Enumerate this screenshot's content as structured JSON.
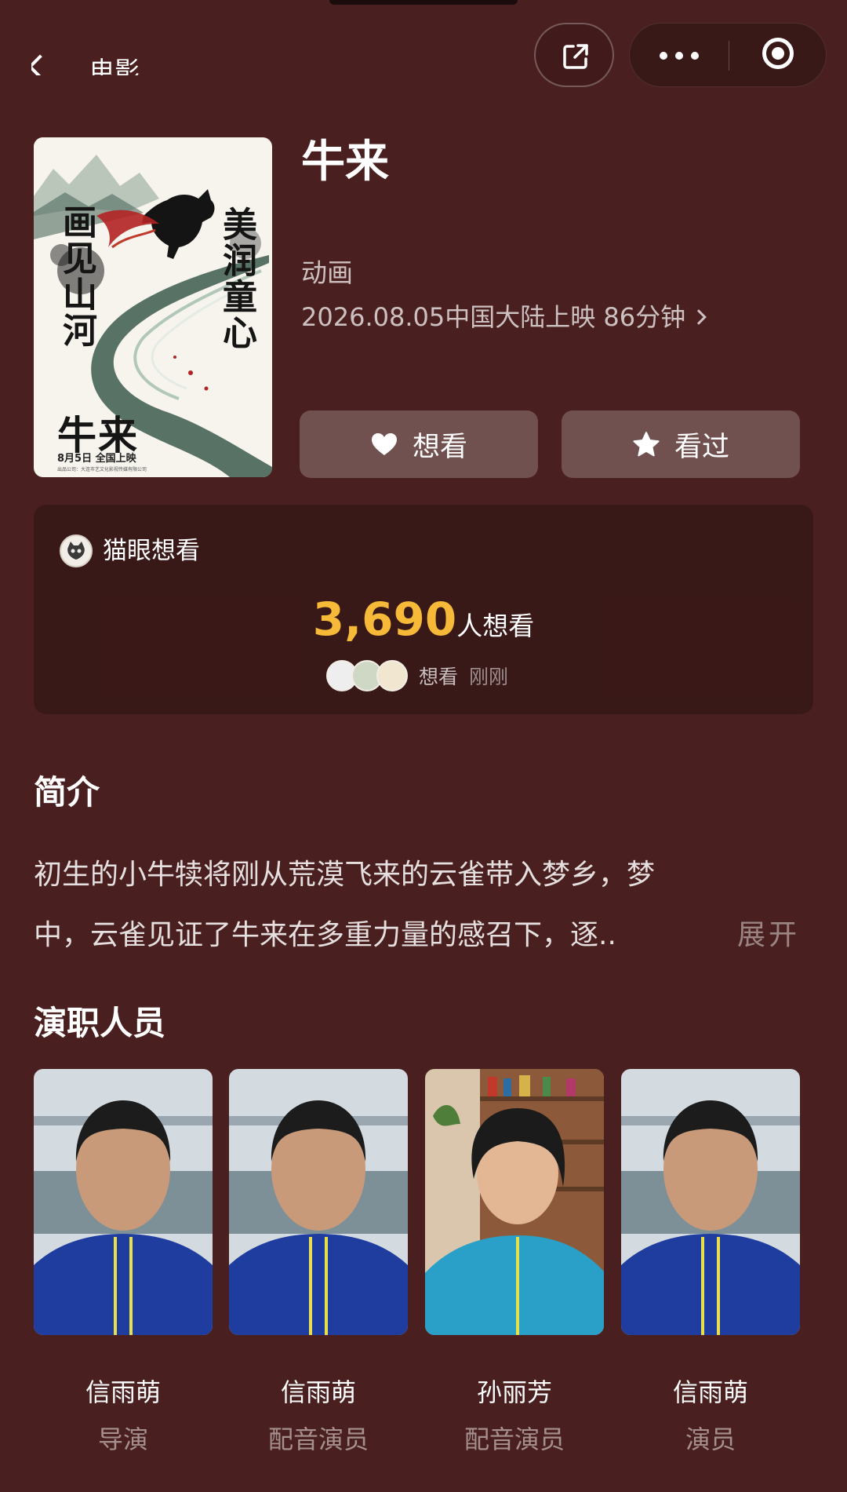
{
  "header": {
    "back_title": "电影",
    "share_icon": "share-icon",
    "more_icon": "more-icon",
    "close_icon": "close-icon"
  },
  "poster": {
    "slogan_left": "画见山河",
    "slogan_right": "美润童心",
    "title": "牛来",
    "date": "8月5日  全国上映",
    "credit": "出品公司：大连市艺文化影视传媒有限公司"
  },
  "movie": {
    "title": "牛来",
    "genre": "动画",
    "release_info": "2026.08.05中国大陆上映 86分钟"
  },
  "actions": {
    "want_label": "想看",
    "watched_label": "看过"
  },
  "maoyan": {
    "label": "猫眼想看",
    "want_count": "3,690",
    "want_suffix": "人想看",
    "activity_action": "想看",
    "activity_time": "刚刚"
  },
  "synopsis": {
    "title": "简介",
    "line1": "初生的小牛犊将刚从荒漠飞来的云雀带入梦乡，梦",
    "line2": "中，云雀见证了牛来在多重力量的感召下，逐..",
    "expand_label": "展开"
  },
  "cast": {
    "title": "演职人员",
    "members": [
      {
        "name": "信雨萌",
        "role": "导演"
      },
      {
        "name": "信雨萌",
        "role": "配音演员"
      },
      {
        "name": "孙丽芳",
        "role": "配音演员"
      },
      {
        "name": "信雨萌",
        "role": "演员"
      }
    ]
  },
  "colors": {
    "background": "#4a1f1f",
    "accent_count": "#f6b938",
    "button_bg": "rgba(255,255,255,0.22)"
  }
}
